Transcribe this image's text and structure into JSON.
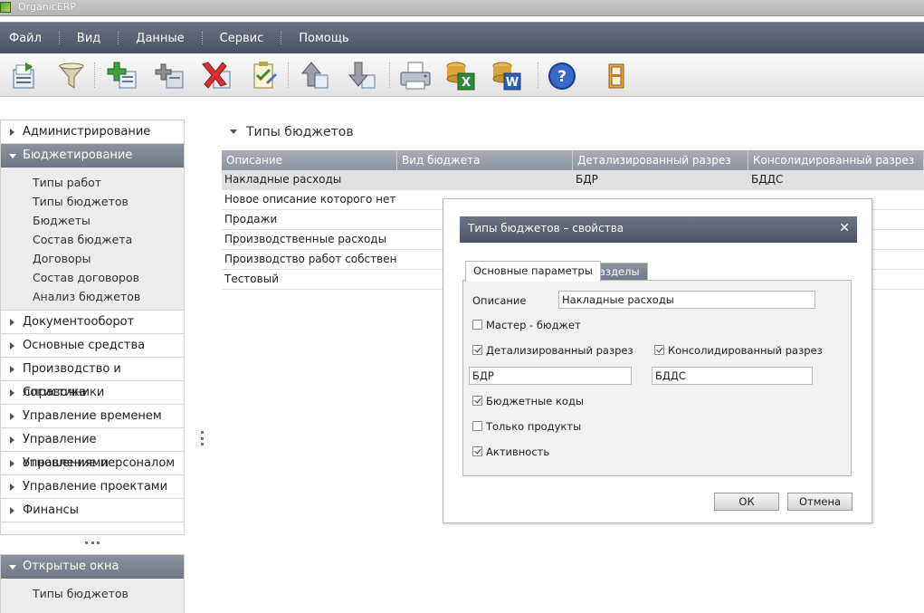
{
  "window": {
    "title": "OrganicERP"
  },
  "menu": [
    "Файл",
    "Вид",
    "Данные",
    "Сервис",
    "Помощь"
  ],
  "toolbar": {
    "buttons": [
      "open-icon",
      "filter-icon",
      "add-icon",
      "add-child-icon",
      "delete-icon",
      "edit-icon",
      "move-up-icon",
      "move-down-icon",
      "print-icon",
      "export-excel-icon",
      "export-word-icon",
      "help-icon",
      "exit-icon"
    ]
  },
  "sidebar": {
    "sections": [
      {
        "label": "Администрирование",
        "expanded": false
      },
      {
        "label": "Бюджетирование",
        "expanded": true,
        "items": [
          "Типы работ",
          "Типы бюджетов",
          "Бюджеты",
          "Состав бюджета",
          "Договоры",
          "Состав договоров",
          "Анализ бюджетов"
        ]
      },
      {
        "label": "Документооборот",
        "expanded": false
      },
      {
        "label": "Основные средства",
        "expanded": false
      },
      {
        "label": "Производство и логистика",
        "expanded": false
      },
      {
        "label": "Справочники",
        "expanded": false
      },
      {
        "label": "Управление временем",
        "expanded": false
      },
      {
        "label": "Управление отношениями",
        "expanded": false
      },
      {
        "label": "Управление персоналом",
        "expanded": false
      },
      {
        "label": "Управление проектами",
        "expanded": false
      },
      {
        "label": "Финансы",
        "expanded": false
      }
    ]
  },
  "open_windows": {
    "label": "Открытые окна",
    "items": [
      "Типы бюджетов"
    ]
  },
  "main": {
    "title": "Типы бюджетов",
    "columns": [
      "Описание",
      "Вид бюджета",
      "Детализированный разрез",
      "Консолидированный разрез"
    ],
    "rows": [
      [
        "Накладные расходы",
        "",
        "БДР",
        "БДДС"
      ],
      [
        "Новое описание которого нет в...",
        "",
        "",
        ""
      ],
      [
        "Продажи",
        "",
        "",
        ""
      ],
      [
        "Производственные расходы",
        "",
        "",
        ""
      ],
      [
        "Производство работ собственн...",
        "",
        "",
        ""
      ],
      [
        "Тестовый",
        "",
        "",
        ""
      ]
    ]
  },
  "dialog": {
    "title": "Типы бюджетов – свойства",
    "tabs": [
      "Основные параметры",
      "Разделы"
    ],
    "description_label": "Описание",
    "description_value": "Накладные расходы",
    "master_label": "Мастер - бюджет",
    "master_checked": false,
    "detailed_label": "Детализированный разрез",
    "detailed_checked": true,
    "detailed_value": "БДР",
    "consolidated_label": "Консолидированный разрез",
    "consolidated_checked": true,
    "consolidated_value": "БДДС",
    "budget_codes_label": "Бюджетные коды",
    "budget_codes_checked": true,
    "products_only_label": "Только продукты",
    "products_only_checked": false,
    "active_label": "Активность",
    "active_checked": true,
    "ok_label": "ОК",
    "cancel_label": "Отмена"
  }
}
